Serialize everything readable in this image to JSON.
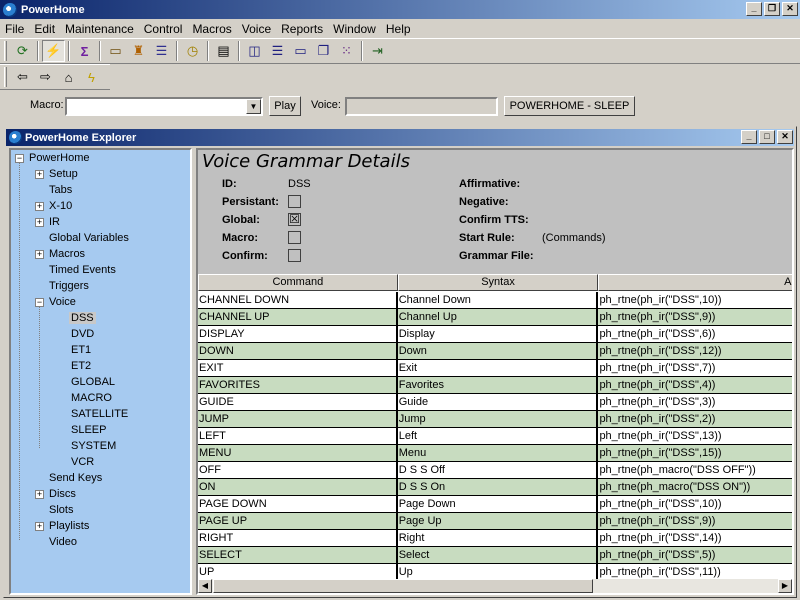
{
  "app": {
    "title": "PowerHome",
    "controls": [
      "_",
      "❐",
      "✕"
    ]
  },
  "menu": [
    "File",
    "Edit",
    "Maintenance",
    "Control",
    "Macros",
    "Voice",
    "Reports",
    "Window",
    "Help"
  ],
  "toolbar": {
    "icons": [
      "refresh-icon",
      "execute-icon",
      "formula-icon",
      "folder-icon",
      "people-icon",
      "list-icon",
      "clock-icon",
      "report-icon",
      "tile-vertical-icon",
      "tile-horizontal-icon",
      "cascade-icon",
      "window-icon",
      "arrange-icon",
      "grid-icon",
      "exit-icon"
    ],
    "nav_icons": [
      "back-arrow-icon",
      "forward-arrow-icon",
      "home-icon",
      "lightning-icon"
    ]
  },
  "macro_row": {
    "macro_label": "Macro:",
    "macro_value": "",
    "play_label": "Play",
    "voice_label": "Voice:",
    "voice_value": "",
    "status_button": "POWERHOME - SLEEP"
  },
  "explorer": {
    "title": "PowerHome Explorer",
    "controls": [
      "_",
      "□",
      "✕"
    ]
  },
  "tree": {
    "root": "PowerHome",
    "items": [
      {
        "label": "Setup",
        "expander": "+"
      },
      {
        "label": "Tabs",
        "expander": ""
      },
      {
        "label": "X-10",
        "expander": "+"
      },
      {
        "label": "IR",
        "expander": "+"
      },
      {
        "label": "Global Variables",
        "expander": ""
      },
      {
        "label": "Macros",
        "expander": "+"
      },
      {
        "label": "Timed Events",
        "expander": ""
      },
      {
        "label": "Triggers",
        "expander": ""
      },
      {
        "label": "Voice",
        "expander": "−"
      }
    ],
    "voice_children": [
      "DSS",
      "DVD",
      "ET1",
      "ET2",
      "GLOBAL",
      "MACRO",
      "SATELLITE",
      "SLEEP",
      "SYSTEM",
      "VCR"
    ],
    "selected": "DSS",
    "after": [
      {
        "label": "Send Keys",
        "expander": ""
      },
      {
        "label": "Discs",
        "expander": "+"
      },
      {
        "label": "Slots",
        "expander": ""
      },
      {
        "label": "Playlists",
        "expander": "+"
      },
      {
        "label": "Video",
        "expander": ""
      }
    ]
  },
  "details": {
    "title": "Voice Grammar Details",
    "id_label": "ID:",
    "id_value": "DSS",
    "persistant_label": "Persistant:",
    "global_label": "Global:",
    "macro_label": "Macro:",
    "confirm_label": "Confirm:",
    "affirmative_label": "Affirmative:",
    "negative_label": "Negative:",
    "confirm_tts_label": "Confirm TTS:",
    "start_rule_label": "Start Rule:",
    "start_rule_value": "(Commands)",
    "grammar_file_label": "Grammar File:",
    "checks": {
      "persistant": false,
      "global": true,
      "macro": false,
      "confirm": false
    },
    "check_mark": "☒"
  },
  "grid": {
    "headers": [
      "Command",
      "Syntax",
      "Ac"
    ],
    "rows": [
      [
        "CHANNEL DOWN",
        "Channel Down",
        "ph_rtne(ph_ir(\"DSS\",10))"
      ],
      [
        "CHANNEL UP",
        "Channel Up",
        "ph_rtne(ph_ir(\"DSS\",9))"
      ],
      [
        "DISPLAY",
        "Display",
        "ph_rtne(ph_ir(\"DSS\",6))"
      ],
      [
        "DOWN",
        "Down",
        "ph_rtne(ph_ir(\"DSS\",12))"
      ],
      [
        "EXIT",
        "Exit",
        "ph_rtne(ph_ir(\"DSS\",7))"
      ],
      [
        "FAVORITES",
        "Favorites",
        "ph_rtne(ph_ir(\"DSS\",4))"
      ],
      [
        "GUIDE",
        "Guide",
        "ph_rtne(ph_ir(\"DSS\",3))"
      ],
      [
        "JUMP",
        "Jump",
        "ph_rtne(ph_ir(\"DSS\",2))"
      ],
      [
        "LEFT",
        "Left",
        "ph_rtne(ph_ir(\"DSS\",13))"
      ],
      [
        "MENU",
        "Menu",
        "ph_rtne(ph_ir(\"DSS\",15))"
      ],
      [
        "OFF",
        "D S S Off",
        "ph_rtne(ph_macro(\"DSS OFF\"))"
      ],
      [
        "ON",
        "D S S On",
        "ph_rtne(ph_macro(\"DSS ON\"))"
      ],
      [
        "PAGE DOWN",
        "Page Down",
        "ph_rtne(ph_ir(\"DSS\",10))"
      ],
      [
        "PAGE UP",
        "Page Up",
        "ph_rtne(ph_ir(\"DSS\",9))"
      ],
      [
        "RIGHT",
        "Right",
        "ph_rtne(ph_ir(\"DSS\",14))"
      ],
      [
        "SELECT",
        "Select",
        "ph_rtne(ph_ir(\"DSS\",5))"
      ],
      [
        "UP",
        "Up",
        "ph_rtne(ph_ir(\"DSS\",11))"
      ]
    ]
  },
  "scrollbar": {
    "left": "◀",
    "right": "▶"
  },
  "colors": {
    "title_start": "#0a246a",
    "title_end": "#a6caf0",
    "tree_bg": "#a6caf0",
    "row_alt": "#c8dcc0"
  }
}
